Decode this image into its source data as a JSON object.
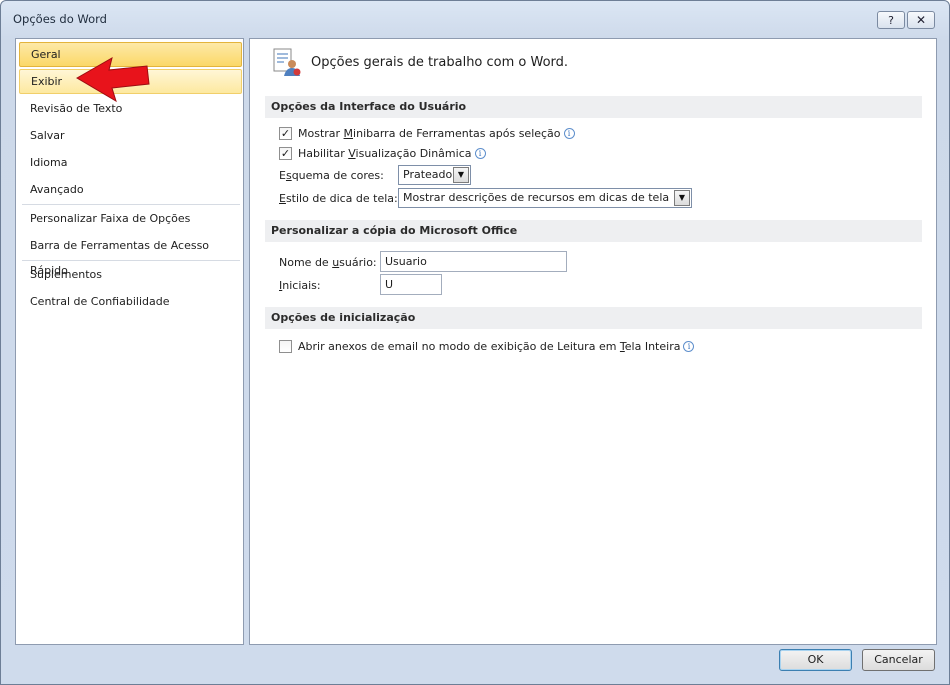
{
  "window": {
    "title": "Opções do Word",
    "help_glyph": "?",
    "close_glyph": "✕"
  },
  "nav": {
    "items": [
      {
        "label": "Geral"
      },
      {
        "label": "Exibir"
      },
      {
        "label": "Revisão de Texto"
      },
      {
        "label": "Salvar"
      },
      {
        "label": "Idioma"
      },
      {
        "label": "Avançado"
      },
      {
        "label": "Personalizar Faixa de Opções"
      },
      {
        "label": "Barra de Ferramentas de Acesso Rápido"
      },
      {
        "label": "Suplementos"
      },
      {
        "label": "Central de Confiabilidade"
      }
    ],
    "selected": "Geral",
    "highlighted": "Exibir"
  },
  "content": {
    "header": "Opções gerais de trabalho com o Word.",
    "ui_section": {
      "title": "Opções da Interface do Usuário",
      "minibar": {
        "pre": "Mostrar ",
        "u": "M",
        "post": "inibarra de Ferramentas após seleção",
        "checked": true
      },
      "live_preview": {
        "pre": "Habilitar ",
        "u": "V",
        "post": "isualização Dinâmica",
        "checked": true
      },
      "color_scheme": {
        "pre": "E",
        "u": "s",
        "post": "quema de cores:",
        "value": "Prateado"
      },
      "screentip": {
        "pre": "",
        "u": "E",
        "post": "stilo de dica de tela:",
        "value": "Mostrar descrições de recursos em dicas de tela"
      }
    },
    "office_section": {
      "title": "Personalizar a cópia do Microsoft Office",
      "username": {
        "pre": "Nome de ",
        "u": "u",
        "post": "suário:",
        "value": "Usuario"
      },
      "initials": {
        "pre": "",
        "u": "I",
        "post": "niciais:",
        "value": "U"
      }
    },
    "startup_section": {
      "title": "Opções de inicialização",
      "reading_mode": {
        "pre": "Abrir anexos de email no modo de exibição de Leitura em ",
        "u": "T",
        "post": "ela Inteira",
        "checked": false
      }
    }
  },
  "buttons": {
    "ok": "OK",
    "cancel": "Cancelar"
  },
  "colors": {
    "selected_nav": "#fbd867",
    "annotation_arrow": "#e8131b",
    "accent_border": "#3c7fb1"
  },
  "checkmark_glyph": "✓",
  "dropdown_glyph": "▼",
  "info_glyph": "i"
}
